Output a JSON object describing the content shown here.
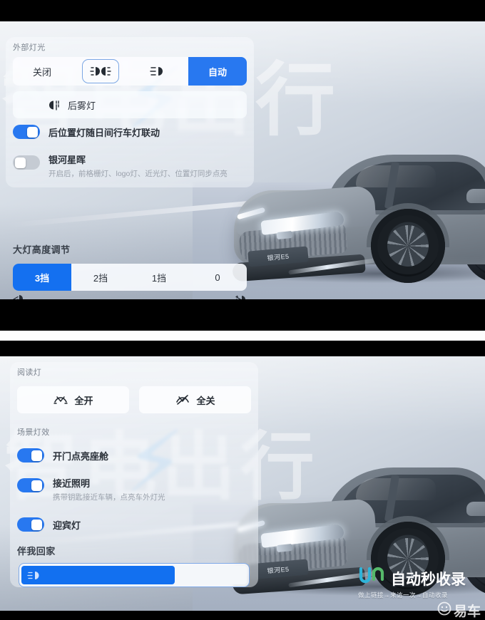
{
  "screen_top": {
    "exterior_lighting": {
      "section_label": "外部灯光",
      "modes": [
        {
          "label": "关闭",
          "icon": "",
          "state": "inactive"
        },
        {
          "label": "",
          "icon": "position-light-icon",
          "state": "outlined"
        },
        {
          "label": "",
          "icon": "low-beam-icon",
          "state": "inactive"
        },
        {
          "label": "自动",
          "icon": "",
          "state": "active"
        }
      ],
      "rear_fog": {
        "label": "后雾灯",
        "icon": "rear-fog-light-icon"
      },
      "drl_link": {
        "label": "后位置灯随日间行车灯联动",
        "toggle": "on"
      },
      "galaxy_starlight": {
        "label": "银河星晖",
        "sub": "开启后，前格栅灯、logo灯、近光灯、位置灯同步点亮",
        "toggle": "off"
      }
    },
    "headlight_height": {
      "section_label": "大灯高度调节",
      "levels": [
        "3挡",
        "2挡",
        "1挡",
        "0"
      ],
      "selected": "3挡",
      "icon_left": "headlight-down-icon",
      "icon_right": "headlight-up-icon"
    }
  },
  "screen_bottom": {
    "reading_light": {
      "section_label": "阅读灯",
      "buttons": [
        {
          "label": "全开",
          "icon": "lights-on-icon"
        },
        {
          "label": "全关",
          "icon": "lights-off-icon"
        }
      ]
    },
    "scene_lighting": {
      "section_label": "场景灯效",
      "items": [
        {
          "label": "开门点亮座舱",
          "sub": "",
          "toggle": "on"
        },
        {
          "label": "接近照明",
          "sub": "携带钥匙接近车辆，点亮车外灯光",
          "toggle": "on"
        },
        {
          "label": "迎宾灯",
          "sub": "",
          "toggle": "on"
        }
      ]
    },
    "follow_me_home": {
      "section_label": "伴我回家",
      "icon": "low-beam-icon",
      "fill_percent": 68
    }
  },
  "vehicle": {
    "plate_text": "银河E5"
  },
  "watermark": {
    "brand_mark": "JN",
    "title": "自动秒收录",
    "tagline": "做上链接→来访一次→自动收录",
    "secondary": "易车"
  },
  "colors": {
    "accent_blue": "#2878f0",
    "active_blue": "#1470f0",
    "outline_blue": "#7ba7e4",
    "toggle_off": "#c5cbd3",
    "panel_bg": "#f7f9fc",
    "text_primary": "#2b313a",
    "text_muted": "#9aa1ab"
  }
}
